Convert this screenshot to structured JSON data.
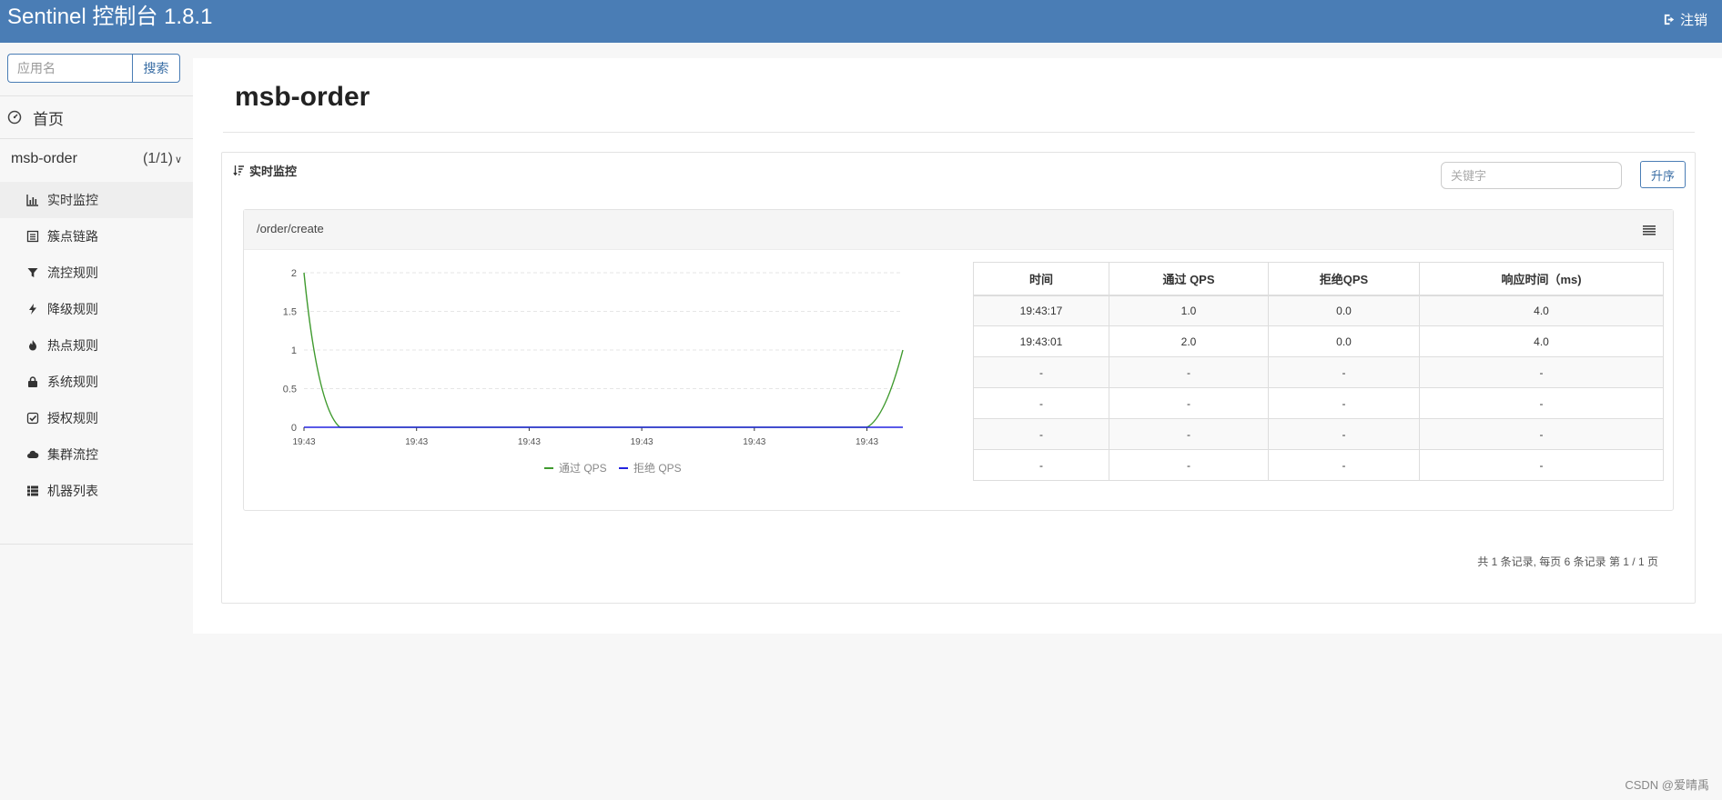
{
  "header": {
    "brand": "Sentinel 控制台 1.8.1",
    "logout_label": "注销"
  },
  "sidebar": {
    "search_placeholder": "应用名",
    "search_button": "搜索",
    "home_label": "首页",
    "app": {
      "name": "msb-order",
      "count": "(1/1)"
    },
    "items": [
      {
        "label": "实时监控",
        "icon": "bar-chart-icon",
        "active": true
      },
      {
        "label": "簇点链路",
        "icon": "list-icon",
        "active": false
      },
      {
        "label": "流控规则",
        "icon": "filter-icon",
        "active": false
      },
      {
        "label": "降级规则",
        "icon": "flash-icon",
        "active": false
      },
      {
        "label": "热点规则",
        "icon": "fire-icon",
        "active": false
      },
      {
        "label": "系统规则",
        "icon": "lock-icon",
        "active": false
      },
      {
        "label": "授权规则",
        "icon": "check-square-icon",
        "active": false
      },
      {
        "label": "集群流控",
        "icon": "cloud-icon",
        "active": false
      },
      {
        "label": "机器列表",
        "icon": "th-list-icon",
        "active": false
      }
    ]
  },
  "main": {
    "title": "msb-order",
    "panel_title": "实时监控",
    "keyword_placeholder": "关键字",
    "sort_button": "升序",
    "resource": "/order/create",
    "table": {
      "headers": [
        "时间",
        "通过 QPS",
        "拒绝QPS",
        "响应时间（ms)"
      ],
      "rows": [
        [
          "19:43:17",
          "1.0",
          "0.0",
          "4.0"
        ],
        [
          "19:43:01",
          "2.0",
          "0.0",
          "4.0"
        ],
        [
          "-",
          "-",
          "-",
          "-"
        ],
        [
          "-",
          "-",
          "-",
          "-"
        ],
        [
          "-",
          "-",
          "-",
          "-"
        ],
        [
          "-",
          "-",
          "-",
          "-"
        ]
      ]
    },
    "pager": "共 1 条记录, 每页 6 条记录 第 1 / 1 页"
  },
  "chart_data": {
    "type": "line",
    "x": [
      "19:43",
      "19:43",
      "19:43",
      "19:43",
      "19:43",
      "19:43"
    ],
    "ylim": [
      0,
      2
    ],
    "yticks": [
      "0",
      "0.5",
      "1",
      "1.5",
      "2"
    ],
    "grid": true,
    "legend_position": "bottom",
    "series": [
      {
        "name": "通过 QPS",
        "color": "#3f9a2e",
        "points": [
          [
            0,
            2
          ],
          [
            0.06,
            0
          ],
          [
            0.94,
            0
          ],
          [
            1,
            1
          ]
        ]
      },
      {
        "name": "拒绝 QPS",
        "color": "#2323e0",
        "points": [
          [
            0,
            0
          ],
          [
            1,
            0
          ]
        ]
      }
    ]
  },
  "watermark": "CSDN @爱晴禹"
}
